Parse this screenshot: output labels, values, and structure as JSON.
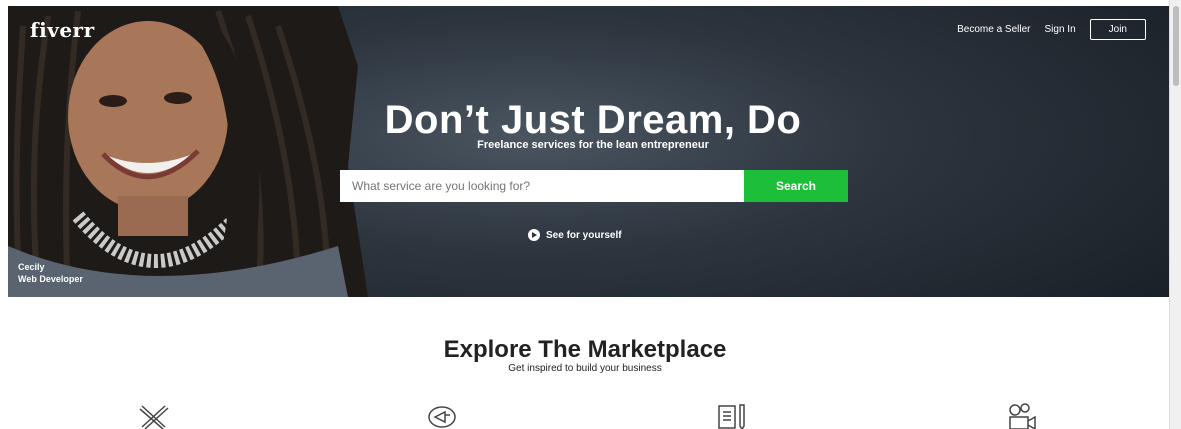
{
  "header": {
    "logo": "fiverr",
    "nav": {
      "become_seller": "Become a Seller",
      "sign_in": "Sign In",
      "join": "Join"
    }
  },
  "hero": {
    "headline": "Don’t Just Dream, Do",
    "subheadline": "Freelance services for the lean entrepreneur",
    "search": {
      "placeholder": "What service are you looking for?",
      "button": "Search"
    },
    "video_link": "See for yourself",
    "caption": {
      "line1": "Cecily",
      "line2": "Web Developer"
    }
  },
  "explore": {
    "title": "Explore The Marketplace",
    "subtitle": "Get inspired to build your business",
    "categories": [
      {
        "icon": "design-tools-icon"
      },
      {
        "icon": "marketing-icon"
      },
      {
        "icon": "writing-icon"
      },
      {
        "icon": "video-animation-icon"
      }
    ]
  },
  "colors": {
    "hero_bg": "#2c343d",
    "accent_green": "#1dbf3a",
    "text_dark": "#222222"
  }
}
